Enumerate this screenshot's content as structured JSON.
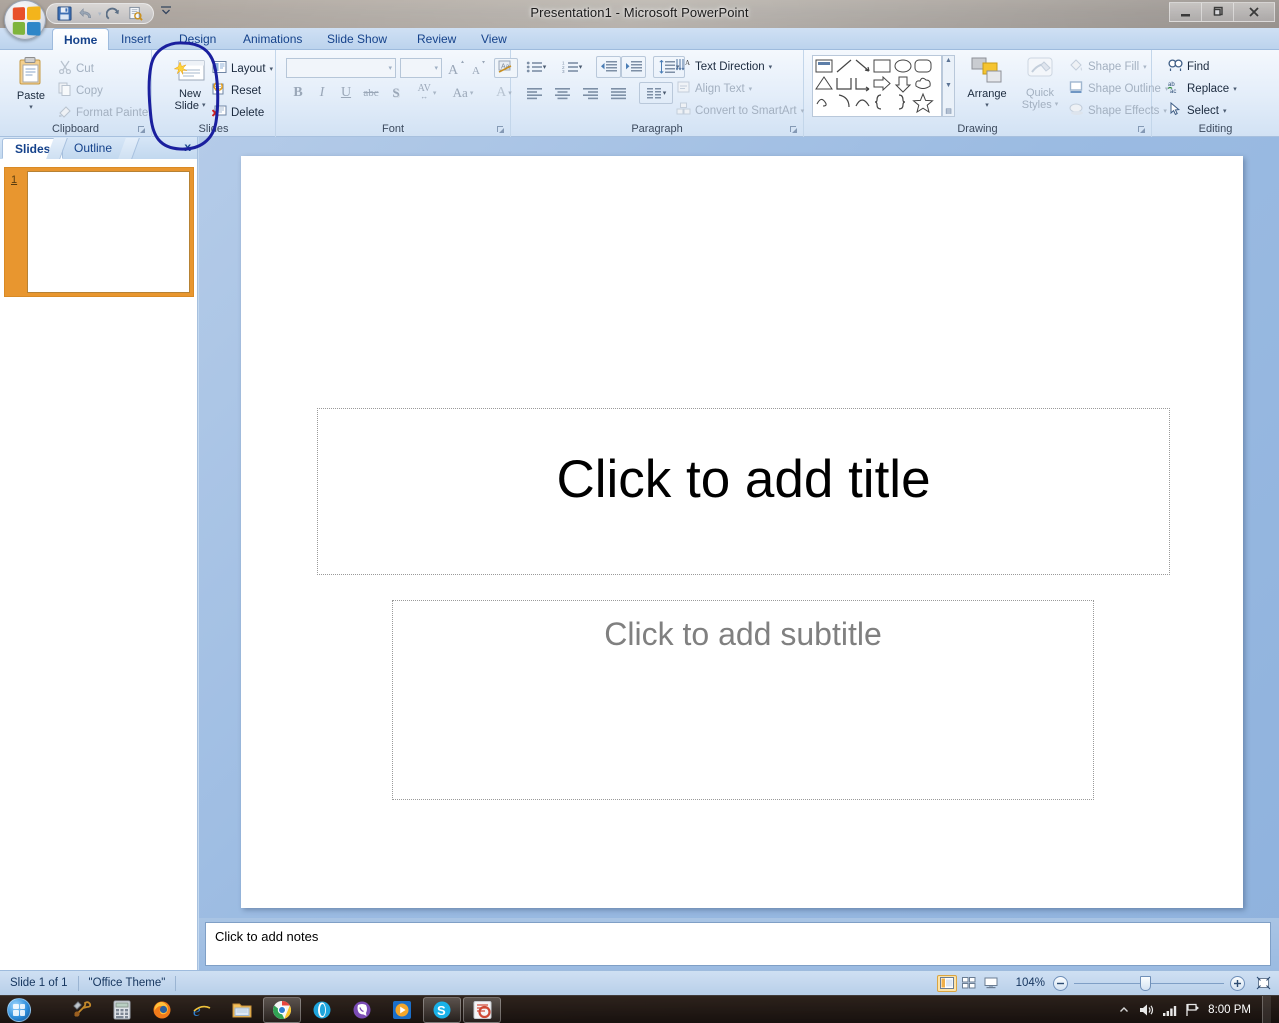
{
  "window": {
    "title": "Presentation1 - Microsoft PowerPoint",
    "controls": {
      "minimize": "Minimize",
      "restore": "Restore Down",
      "close": "Close"
    }
  },
  "office_button": {
    "label": "Office Button"
  },
  "quick_access": {
    "items": [
      {
        "name": "save-icon",
        "label": "Save"
      },
      {
        "name": "undo-icon",
        "label": "Undo"
      },
      {
        "name": "redo-icon",
        "label": "Redo"
      },
      {
        "name": "print-preview-icon",
        "label": "Print Preview"
      }
    ],
    "customize_label": "Customize Quick Access Toolbar"
  },
  "ribbon": {
    "tabs": [
      {
        "label": "Home",
        "active": true
      },
      {
        "label": "Insert",
        "active": false
      },
      {
        "label": "Design",
        "active": false
      },
      {
        "label": "Animations",
        "active": false
      },
      {
        "label": "Slide Show",
        "active": false
      },
      {
        "label": "Review",
        "active": false
      },
      {
        "label": "View",
        "active": false
      }
    ],
    "groups": {
      "clipboard": {
        "label": "Clipboard",
        "paste": "Paste",
        "cut": "Cut",
        "copy": "Copy",
        "format_painter": "Format Painter"
      },
      "slides": {
        "label": "Slides",
        "new_slide_line1": "New",
        "new_slide_line2": "Slide",
        "layout": "Layout",
        "reset": "Reset",
        "delete": "Delete"
      },
      "font": {
        "label": "Font",
        "font_name_value": "",
        "font_size_value": "",
        "grow_font": "Increase Font Size",
        "shrink_font": "Decrease Font Size",
        "clear_formatting": "Clear All Formatting",
        "bold": "B",
        "italic": "I",
        "underline": "U",
        "strikethrough": "abc",
        "shadow": "S",
        "char_spacing": "AV",
        "change_case": "Aa",
        "font_color": "A"
      },
      "paragraph": {
        "label": "Paragraph",
        "bullets": "Bullets",
        "numbering": "Numbering",
        "decrease_indent": "Decrease List Level",
        "increase_indent": "Increase List Level",
        "line_spacing": "Line Spacing",
        "align_left": "Align Text Left",
        "center": "Center",
        "align_right": "Align Text Right",
        "justify": "Justify",
        "columns": "Columns",
        "text_direction": "Text Direction",
        "align_text": "Align Text",
        "convert_smartart": "Convert to SmartArt"
      },
      "drawing": {
        "label": "Drawing",
        "arrange": "Arrange",
        "quick_styles_line1": "Quick",
        "quick_styles_line2": "Styles",
        "shape_fill": "Shape Fill",
        "shape_outline": "Shape Outline",
        "shape_effects": "Shape Effects",
        "shapes_gallery": "Shapes Gallery"
      },
      "editing": {
        "label": "Editing",
        "find": "Find",
        "replace": "Replace",
        "select": "Select"
      }
    }
  },
  "slides_pane": {
    "tabs": [
      {
        "label": "Slides",
        "active": true
      },
      {
        "label": "Outline",
        "active": false
      }
    ],
    "close_label": "x",
    "thumbnails": [
      {
        "number": "1"
      }
    ]
  },
  "slide": {
    "title_placeholder": "Click to add title",
    "subtitle_placeholder": "Click to add subtitle"
  },
  "notes": {
    "placeholder": "Click to add notes"
  },
  "status_bar": {
    "slide_counter": "Slide 1 of 1",
    "theme": "\"Office Theme\"",
    "zoom_level": "104%",
    "views": [
      {
        "name": "normal-view",
        "label": "Normal",
        "active": true
      },
      {
        "name": "slide-sorter-view",
        "label": "Slide Sorter",
        "active": false
      },
      {
        "name": "slide-show-view",
        "label": "Slide Show",
        "active": false
      }
    ],
    "zoom_out_label": "Zoom Out",
    "zoom_in_label": "Zoom In",
    "fit_label": "Fit slide to current window"
  },
  "annotation": {
    "shape": "hand-drawn-ellipse",
    "color": "#1a1f9e",
    "target": "New Slide"
  },
  "taskbar": {
    "start_label": "Start",
    "items": [
      {
        "name": "taskbar-item-tool",
        "label": "Tool",
        "running": false
      },
      {
        "name": "taskbar-item-calculator",
        "label": "Calculator",
        "running": false
      },
      {
        "name": "taskbar-item-firefox",
        "label": "Mozilla Firefox",
        "running": false
      },
      {
        "name": "taskbar-item-internet-explorer",
        "label": "Internet Explorer",
        "running": false
      },
      {
        "name": "taskbar-item-file-explorer",
        "label": "Windows Explorer",
        "running": false
      },
      {
        "name": "taskbar-item-chrome",
        "label": "Google Chrome",
        "running": true
      },
      {
        "name": "taskbar-item-opera",
        "label": "Opera",
        "running": false
      },
      {
        "name": "taskbar-item-viber",
        "label": "Viber",
        "running": false
      },
      {
        "name": "taskbar-item-media-player",
        "label": "Media Player",
        "running": false
      },
      {
        "name": "taskbar-item-skype",
        "label": "Skype",
        "running": true
      },
      {
        "name": "taskbar-item-powerpoint",
        "label": "Microsoft PowerPoint",
        "running": true
      }
    ],
    "tray": {
      "show_hidden_label": "Show hidden icons",
      "volume_label": "Volume",
      "network_label": "Network",
      "action_center_label": "Action Center",
      "clock": "8:00 PM"
    }
  }
}
